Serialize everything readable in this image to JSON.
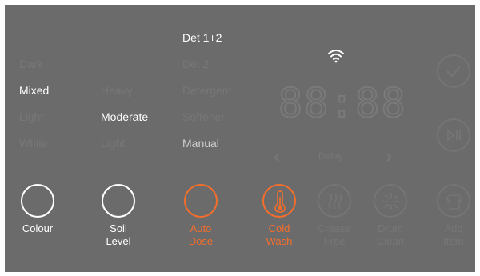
{
  "colour": {
    "options": [
      "Dark",
      "Mixed",
      "Light",
      "White"
    ],
    "selected": "Mixed",
    "label": "Colour"
  },
  "soil": {
    "options": [
      "Heavy",
      "Moderate",
      "Light"
    ],
    "selected": "Moderate",
    "label_line1": "Soil",
    "label_line2": "Level"
  },
  "detergent": {
    "options": [
      "Det 1+2",
      "Det 2",
      "Detergent",
      "Softener",
      "Manual"
    ],
    "selected": "Det 1+2"
  },
  "auto_dose": {
    "label_line1": "Auto",
    "label_line2": "Dose"
  },
  "cold_wash": {
    "label_line1": "Cold",
    "label_line2": "Wash"
  },
  "crease_free": {
    "label_line1": "Crease",
    "label_line2": "Free"
  },
  "drum_clean": {
    "label_line1": "Drum",
    "label_line2": "Clean"
  },
  "add_item": {
    "label_line1": "Add",
    "label_line2": "Item"
  },
  "display": {
    "time": "88:88",
    "delay_label": "Delay"
  },
  "colors": {
    "panel": "#6b6b6b",
    "active": "#ffffff",
    "inactive": "#777777",
    "accent": "#f36e2c"
  },
  "icons": [
    "wifi-icon",
    "check-icon",
    "play-pause-icon",
    "thermometer-icon",
    "crease-free-icon",
    "drum-clean-icon",
    "add-item-icon",
    "chevron-left-icon",
    "chevron-right-icon"
  ]
}
